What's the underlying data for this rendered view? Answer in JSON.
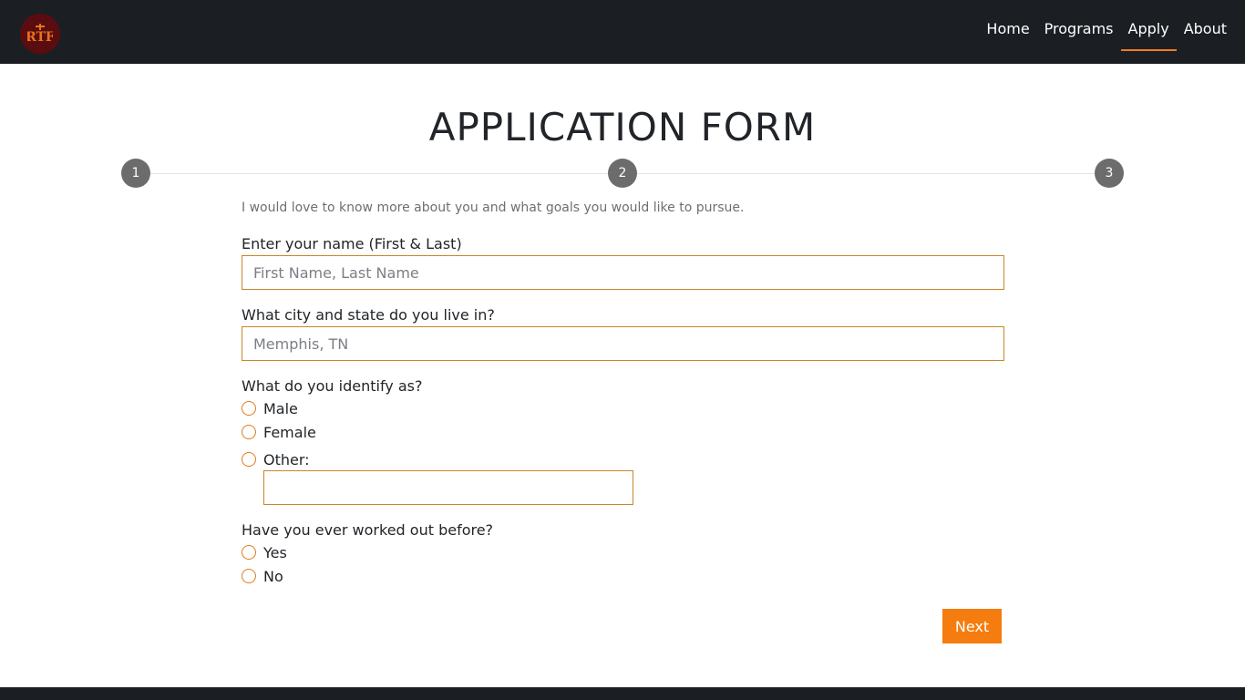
{
  "nav": {
    "logo_text": "RTF",
    "links": [
      {
        "label": "Home"
      },
      {
        "label": "Programs"
      },
      {
        "label": "Apply",
        "active": true
      },
      {
        "label": "About"
      }
    ]
  },
  "page": {
    "title": "APPLICATION FORM",
    "steps": [
      "1",
      "2",
      "3"
    ],
    "intro": "I would love to know more about you and what goals you would like to pursue."
  },
  "form": {
    "name": {
      "label": "Enter your name (First & Last)",
      "placeholder": "First Name, Last Name",
      "value": ""
    },
    "city": {
      "label": "What city and state do you live in?",
      "placeholder": "Memphis, TN",
      "value": ""
    },
    "identify": {
      "label": "What do you identify as?",
      "options": [
        "Male",
        "Female",
        "Other:"
      ],
      "other_value": ""
    },
    "worked_out": {
      "label": "Have you ever worked out before?",
      "options": [
        "Yes",
        "No"
      ]
    },
    "next_label": "Next"
  },
  "colors": {
    "accent": "#f57c0e",
    "input_border": "#c8862a",
    "navbar_bg": "#1b1f23",
    "logo_bg": "#5a0d10",
    "step_bg": "#6c6c6c"
  }
}
